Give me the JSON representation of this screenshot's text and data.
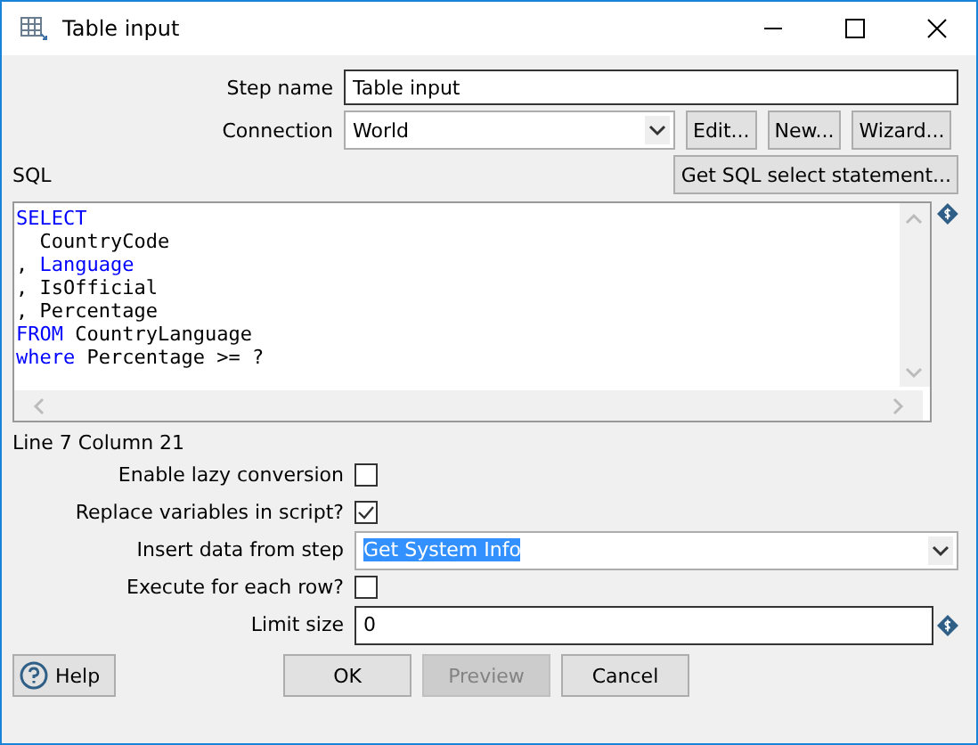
{
  "window": {
    "title": "Table input"
  },
  "step_name": {
    "label": "Step name",
    "value": "Table input"
  },
  "connection": {
    "label": "Connection",
    "value": "World",
    "buttons": [
      "Edit...",
      "New...",
      "Wizard..."
    ]
  },
  "sql": {
    "label": "SQL",
    "get_button": "Get SQL select statement...",
    "lines": [
      [
        {
          "text": "SELECT",
          "kind": "keyword"
        }
      ],
      [
        {
          "text": "  CountryCode",
          "kind": "plain"
        }
      ],
      [
        {
          "text": ", ",
          "kind": "plain"
        },
        {
          "text": "Language",
          "kind": "keyword"
        }
      ],
      [
        {
          "text": ", IsOfficial",
          "kind": "plain"
        }
      ],
      [
        {
          "text": ", Percentage",
          "kind": "plain"
        }
      ],
      [
        {
          "text": "FROM",
          "kind": "keyword"
        },
        {
          "text": " CountryLanguage",
          "kind": "plain"
        }
      ],
      [
        {
          "text": "where",
          "kind": "keyword"
        },
        {
          "text": " Percentage >= ?",
          "kind": "plain"
        }
      ]
    ],
    "position": "Line 7 Column 21"
  },
  "options": [
    {
      "kind": "checkbox",
      "label": "Enable lazy conversion",
      "checked": false
    },
    {
      "kind": "checkbox",
      "label": "Replace variables in script?",
      "checked": true
    },
    {
      "kind": "dropdown",
      "label": "Insert data from step",
      "value": "Get System Info",
      "highlighted": true
    },
    {
      "kind": "checkbox",
      "label": "Execute for each row?",
      "checked": false
    },
    {
      "kind": "text",
      "label": "Limit size",
      "value": "0"
    }
  ],
  "help_button": "Help",
  "buttons": [
    {
      "label": "OK",
      "disabled": false
    },
    {
      "label": "Preview",
      "disabled": true
    },
    {
      "label": "Cancel",
      "disabled": false
    }
  ]
}
